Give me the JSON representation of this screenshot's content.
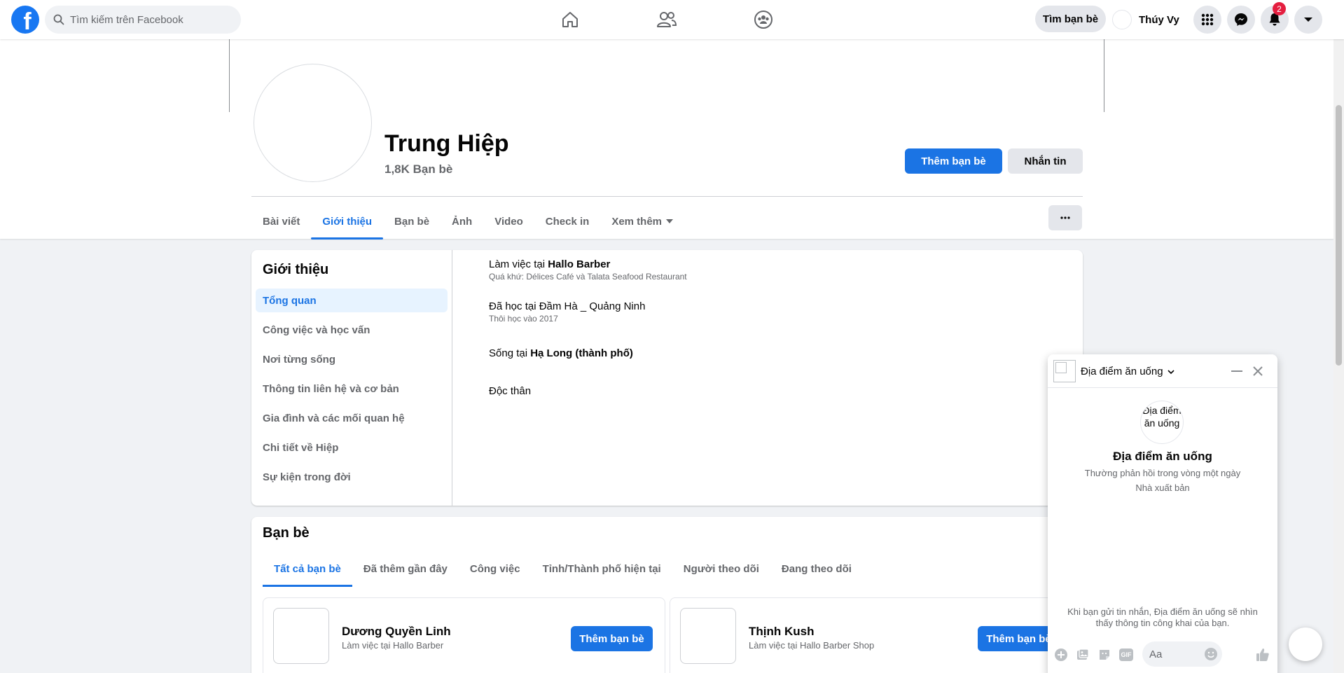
{
  "topbar": {
    "logo": "f",
    "search_placeholder": "Tìm kiếm trên Facebook",
    "find_friends": "Tìm bạn bè",
    "user_name": "Thúy Vy",
    "notification_count": "2",
    "icons": [
      "home-icon",
      "friends-icon",
      "groups-icon",
      "menu-grid-icon",
      "messenger-icon",
      "bell-icon",
      "caret-down-icon"
    ]
  },
  "profile": {
    "name": "Trung Hiệp",
    "friends_count": "1,8K Bạn bè",
    "add_friend": "Thêm bạn bè",
    "message": "Nhắn tin"
  },
  "tabs": [
    {
      "label": "Bài viết"
    },
    {
      "label": "Giới thiệu",
      "active": true
    },
    {
      "label": "Bạn bè"
    },
    {
      "label": "Ảnh"
    },
    {
      "label": "Video"
    },
    {
      "label": "Check in"
    },
    {
      "label": "Xem thêm"
    }
  ],
  "intro": {
    "title": "Giới thiệu",
    "menu": [
      "Tổng quan",
      "Công việc và học vấn",
      "Nơi từng sống",
      "Thông tin liên hệ và cơ bản",
      "Gia đình và các mối quan hệ",
      "Chi tiết về Hiệp",
      "Sự kiện trong đời"
    ],
    "work_prefix": "Làm việc tại ",
    "work_place": "Hallo Barber",
    "work_past": "Quá khứ: Délices Café và Talata Seafood Restaurant",
    "school": "Đã học tại Đầm Hà _ Quảng Ninh",
    "school_sub": "Thôi học vào 2017",
    "lives_prefix": "Sống tại ",
    "lives_place": "Hạ Long (thành phố)",
    "relationship": "Độc thân"
  },
  "friends": {
    "title": "Bạn bè",
    "tabs": [
      "Tất cả bạn bè",
      "Đã thêm gần đây",
      "Công việc",
      "Tỉnh/Thành phố hiện tại",
      "Người theo dõi",
      "Đang theo dõi"
    ],
    "items": [
      {
        "name": "Dương Quyền Linh",
        "sub": "Làm việc tại Hallo Barber",
        "button": "Thêm bạn bè"
      },
      {
        "name": "Thịnh Kush",
        "sub": "Làm việc tại Hallo Barber Shop",
        "button": "Thêm bạn bè"
      }
    ]
  },
  "chat": {
    "page_name": "Địa điểm ăn uống",
    "avatar_alt": "Địa điểm ăn uống",
    "title": "Địa điểm ăn uống",
    "response": "Thường phản hồi trong vòng một ngày",
    "role": "Nhà xuất bản",
    "note": "Khi bạn gửi tin nhắn, Địa điểm ăn uống sẽ nhìn thấy thông tin công khai của bạn.",
    "input_placeholder": "Aa",
    "gif": "GIF"
  },
  "colors": {
    "accent": "#1b74e4",
    "logo": "#1877f2",
    "badge": "#e41e3f",
    "background": "#f0f2f5"
  }
}
